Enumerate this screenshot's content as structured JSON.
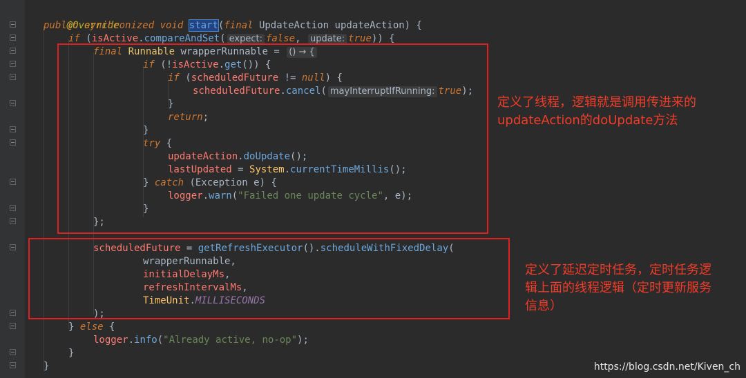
{
  "code": {
    "l1": {
      "ann": "@Override"
    },
    "l2": {
      "kw1": "public",
      "kw2": "synchronized",
      "kw3": "void",
      "method": "start",
      "p1": "(",
      "kw4": "final",
      "type": "UpdateAction",
      "rest": " updateAction) {"
    },
    "l3": {
      "kw": "if",
      "p1": " (",
      "field": "isActive",
      "dot": ".",
      "method": "compareAndSet",
      "p2": "(",
      "hint1": "expect:",
      "kw2": "false",
      "p3": ",",
      "hint2": "update:",
      "kw3": "true",
      "p4": ")) {"
    },
    "l4": {
      "kw": "final",
      "type": "Runnable",
      "rest": " wrapperRunnable = ",
      "lambda": "() → {"
    },
    "l5": {
      "kw": "if",
      "p1": " (!",
      "field": "isActive",
      "dot": ".",
      "method": "get",
      "p2": "()) {"
    },
    "l6": {
      "kw": "if",
      "p1": " (",
      "field": "scheduledFuture",
      "p2": " != ",
      "kw2": "null",
      "p3": ") {"
    },
    "l7": {
      "field": "scheduledFuture",
      "dot": ".",
      "method": "cancel",
      "p1": "(",
      "hint": "mayInterruptIfRunning:",
      "kw": "true",
      "p2": ");"
    },
    "l8": {
      "text": "}"
    },
    "l9": {
      "kw": "return",
      "p1": ";"
    },
    "l10": {
      "text": "}"
    },
    "l11": {
      "kw": "try",
      "p1": " {"
    },
    "l12": {
      "field": "updateAction",
      "dot": ".",
      "method": "doUpdate",
      "p1": "();"
    },
    "l13": {
      "field": "lastUpdated",
      "p1": " = ",
      "cls": "System",
      "dot": ".",
      "method": "currentTimeMillis",
      "p2": "();"
    },
    "l14": {
      "p1": "} ",
      "kw": "catch",
      "p2": " (",
      "type": "Exception",
      "p3": " e) {"
    },
    "l15": {
      "field": "logger",
      "dot": ".",
      "method": "warn",
      "p1": "(",
      "str": "\"Failed one update cycle\"",
      "p2": ", e);"
    },
    "l16": {
      "text": "}"
    },
    "l17": {
      "text": "};"
    },
    "l18": {
      "field": "scheduledFuture",
      "p1": " = ",
      "method": "getRefreshExecutor",
      "p2": "().",
      "method2": "scheduleWithFixedDelay",
      "p3": "("
    },
    "l19": {
      "text": "wrapperRunnable,"
    },
    "l20": {
      "field": "initialDelayMs",
      "p1": ","
    },
    "l21": {
      "field": "refreshIntervalMs",
      "p1": ","
    },
    "l22": {
      "cls": "TimeUnit",
      "dot": ".",
      "const": "MILLISECONDS"
    },
    "l23": {
      "text": ");"
    },
    "l24": {
      "p1": "} ",
      "kw": "else",
      "p2": " {"
    },
    "l25": {
      "field": "logger",
      "dot": ".",
      "method": "info",
      "p1": "(",
      "str": "\"Already active, no-op\"",
      "p2": ");"
    },
    "l26": {
      "text": "}"
    },
    "l27": {
      "text": "}"
    }
  },
  "annotations": {
    "box1_text_line1": "定义了线程，逻辑就是调用传进来的",
    "box1_text_line2": "updateAction的doUpdate方法",
    "box2_text_line1": "定义了延迟定时任务，定时任务逻",
    "box2_text_line2": "辑上面的线程逻辑（定时更新服务",
    "box2_text_line3": "信息）"
  },
  "watermark": "https://blog.csdn.net/Kiven_ch",
  "colors": {
    "background": "#2b2b2b",
    "keyword": "#cc7832",
    "annotation": "#bbb529",
    "field": "#ff7b72",
    "method": "#6fa8dc",
    "string": "#6a8759",
    "constant": "#9876aa",
    "highlight_box": "#e02020"
  }
}
